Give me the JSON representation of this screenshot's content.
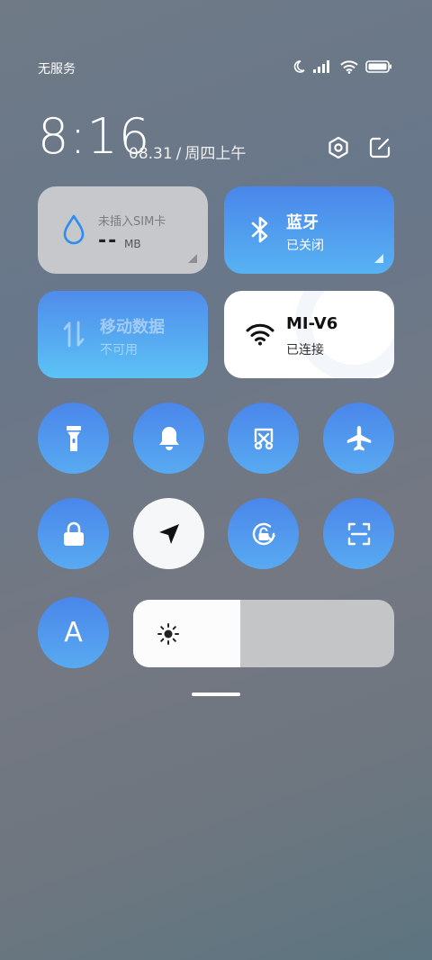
{
  "status_bar": {
    "carrier": "无服务",
    "icons": [
      "moon-icon",
      "signal-icon",
      "wifi-icon",
      "battery-icon"
    ]
  },
  "header": {
    "time": "8:16",
    "date": "08.31",
    "separator": "/",
    "weekday": "周四上午",
    "icons": [
      "settings-icon",
      "edit-icon"
    ]
  },
  "tiles": {
    "sim": {
      "label": "未插入SIM卡",
      "value": "--",
      "unit": "MB",
      "icon": "water-drop-icon"
    },
    "bluetooth": {
      "label": "蓝牙",
      "status": "已关闭",
      "icon": "bluetooth-icon"
    },
    "mobile_data": {
      "label": "移动数据",
      "status": "不可用",
      "icon": "data-arrows-icon"
    },
    "wifi": {
      "label": "MI-V6",
      "status": "已连接",
      "icon": "wifi-icon"
    }
  },
  "toggles": [
    {
      "name": "flashlight",
      "icon": "flashlight-icon",
      "active": true
    },
    {
      "name": "ring",
      "icon": "bell-icon",
      "active": true
    },
    {
      "name": "screenshot",
      "icon": "scissors-icon",
      "active": true
    },
    {
      "name": "airplane",
      "icon": "airplane-icon",
      "active": true
    },
    {
      "name": "lock",
      "icon": "lock-icon",
      "active": true
    },
    {
      "name": "location",
      "icon": "location-arrow-icon",
      "active": false
    },
    {
      "name": "rotation-lock",
      "icon": "rotation-lock-icon",
      "active": true
    },
    {
      "name": "scanner",
      "icon": "scan-icon",
      "active": true
    },
    {
      "name": "auto-brightness",
      "icon": "letter-a-icon",
      "label": "A",
      "active": true
    }
  ],
  "brightness": {
    "level": 0.41,
    "icon": "sun-icon"
  },
  "colors": {
    "accent": "#4a86ea",
    "tile_gray": "#c7c8cb"
  }
}
